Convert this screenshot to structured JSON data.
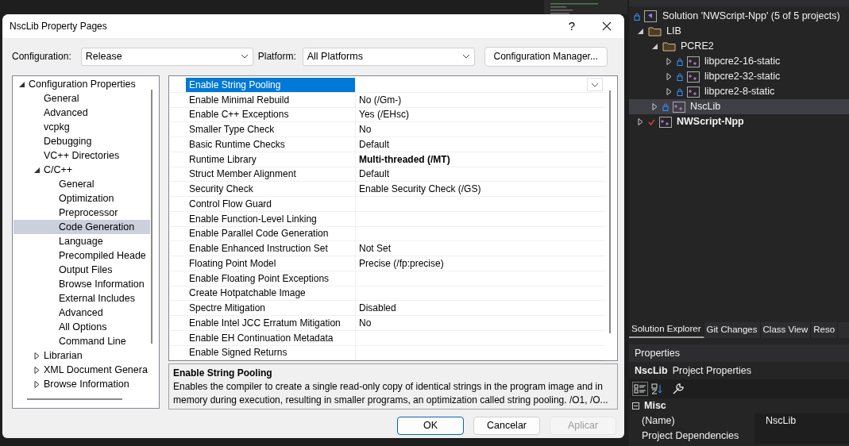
{
  "dialog": {
    "title": "NscLib Property Pages",
    "help": "?",
    "configuration": {
      "label": "Configuration:",
      "value": "Release"
    },
    "platform": {
      "label": "Platform:",
      "value": "All Platforms"
    },
    "config_manager": "Configuration Manager...",
    "tree": [
      {
        "label": "Configuration Properties",
        "expanded": true,
        "selected": false,
        "children": [
          {
            "label": "General",
            "selected": false
          },
          {
            "label": "Advanced",
            "selected": false
          },
          {
            "label": "vcpkg",
            "selected": false
          },
          {
            "label": "Debugging",
            "selected": false
          },
          {
            "label": "VC++ Directories",
            "selected": false
          },
          {
            "label": "C/C++",
            "expanded": true,
            "selected": false,
            "children": [
              {
                "label": "General",
                "selected": false
              },
              {
                "label": "Optimization",
                "selected": false
              },
              {
                "label": "Preprocessor",
                "selected": false
              },
              {
                "label": "Code Generation",
                "selected": true
              },
              {
                "label": "Language",
                "selected": false
              },
              {
                "label": "Precompiled Heade",
                "selected": false
              },
              {
                "label": "Output Files",
                "selected": false
              },
              {
                "label": "Browse Information",
                "selected": false
              },
              {
                "label": "External Includes",
                "selected": false
              },
              {
                "label": "Advanced",
                "selected": false
              },
              {
                "label": "All Options",
                "selected": false
              },
              {
                "label": "Command Line",
                "selected": false
              }
            ]
          },
          {
            "label": "Librarian",
            "expanded": false,
            "selected": false
          },
          {
            "label": "XML Document Genera",
            "expanded": false,
            "selected": false
          },
          {
            "label": "Browse Information",
            "expanded": false,
            "selected": false
          }
        ]
      }
    ],
    "properties": [
      {
        "name": "Enable String Pooling",
        "selected": true
      },
      {
        "name": "Enable Minimal Rebuild",
        "value": "No (/Gm-)",
        "selected": false,
        "bold": false
      },
      {
        "name": "Enable C++ Exceptions",
        "value": "Yes (/EHsc)",
        "selected": false,
        "bold": false
      },
      {
        "name": "Smaller Type Check",
        "value": "No",
        "selected": false,
        "bold": false
      },
      {
        "name": "Basic Runtime Checks",
        "value": "Default",
        "selected": false,
        "bold": false
      },
      {
        "name": "Runtime Library",
        "value": "Multi-threaded (/MT)",
        "selected": false,
        "bold": true
      },
      {
        "name": "Struct Member Alignment",
        "value": "Default",
        "selected": false,
        "bold": false
      },
      {
        "name": "Security Check",
        "value": "Enable Security Check (/GS)",
        "selected": false,
        "bold": false
      },
      {
        "name": "Control Flow Guard",
        "selected": false
      },
      {
        "name": "Enable Function-Level Linking",
        "selected": false
      },
      {
        "name": "Enable Parallel Code Generation",
        "selected": false
      },
      {
        "name": "Enable Enhanced Instruction Set",
        "value": "Not Set",
        "selected": false,
        "bold": false
      },
      {
        "name": "Floating Point Model",
        "value": "Precise (/fp:precise)",
        "selected": false,
        "bold": false
      },
      {
        "name": "Enable Floating Point Exceptions",
        "selected": false
      },
      {
        "name": "Create Hotpatchable Image",
        "selected": false
      },
      {
        "name": "Spectre Mitigation",
        "value": "Disabled",
        "selected": false,
        "bold": false
      },
      {
        "name": "Enable Intel JCC Erratum Mitigation",
        "value": "No",
        "selected": false,
        "bold": false
      },
      {
        "name": "Enable EH Continuation Metadata",
        "selected": false
      },
      {
        "name": "Enable Signed Returns",
        "selected": false
      }
    ],
    "description": {
      "title": "Enable String Pooling",
      "text": "Enables the compiler to create a single read-only copy of identical strings in the program image and in memory during execution, resulting in smaller programs, an optimization called string pooling. /O1, /O..."
    },
    "buttons": [
      {
        "label": "OK",
        "default": true,
        "disabled": false
      },
      {
        "label": "Cancelar",
        "default": false,
        "disabled": false
      },
      {
        "label": "Aplicar",
        "default": false,
        "disabled": true
      }
    ]
  },
  "solution_explorer": {
    "items": [
      {
        "label": "Solution 'NWScript-Npp' (5 of 5 projects)",
        "kind": "solution",
        "locked": true,
        "selected": false,
        "children": [
          {
            "label": "LIB",
            "kind": "folder",
            "expanded": true,
            "selected": false,
            "children": [
              {
                "label": "PCRE2",
                "kind": "folder",
                "expanded": true,
                "selected": false,
                "children": [
                  {
                    "label": "libpcre2-16-static",
                    "kind": "project",
                    "expanded": false,
                    "locked": true,
                    "selected": false
                  },
                  {
                    "label": "libpcre2-32-static",
                    "kind": "project",
                    "expanded": false,
                    "locked": true,
                    "selected": false
                  },
                  {
                    "label": "libpcre2-8-static",
                    "kind": "project",
                    "expanded": false,
                    "locked": true,
                    "selected": false
                  }
                ]
              },
              {
                "label": "NscLib",
                "kind": "project",
                "expanded": false,
                "locked": true,
                "selected": true
              }
            ]
          },
          {
            "label": "NWScript-Npp",
            "kind": "project",
            "expanded": false,
            "startup": true,
            "selected": false
          }
        ]
      }
    ],
    "tabs": [
      {
        "label": "Solution Explorer",
        "selected": true
      },
      {
        "label": "Git Changes",
        "selected": false
      },
      {
        "label": "Class View",
        "selected": false
      },
      {
        "label": "Reso",
        "selected": false
      }
    ]
  },
  "properties_panel": {
    "title": "Properties",
    "object_name": "NscLib",
    "object_type": "Project Properties",
    "categories": [
      {
        "name": "Misc",
        "expanded": true,
        "rows": [
          {
            "name": "(Name)",
            "value": "NscLib"
          },
          {
            "name": "Project Dependencies"
          }
        ]
      }
    ]
  }
}
